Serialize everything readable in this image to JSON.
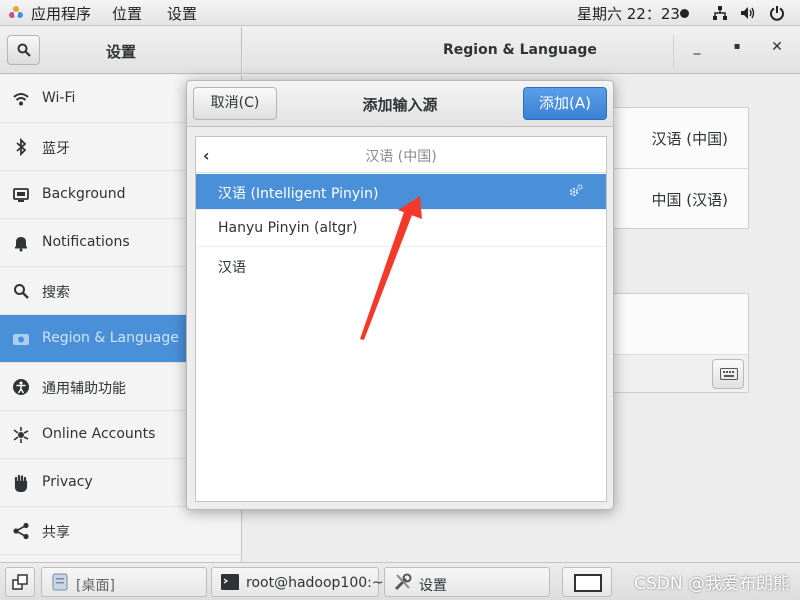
{
  "topbar": {
    "apps_label": "应用程序",
    "places_label": "位置",
    "settings_label": "设置",
    "clock": "星期六 22：23"
  },
  "window": {
    "sidebar_title": "设置",
    "panel_title": "Region & Language",
    "minimize_glyph": "_",
    "maximize_glyph": "▪",
    "close_glyph": "✕"
  },
  "sidebar": {
    "items": [
      {
        "label": "Wi-Fi",
        "icon": "wifi-icon"
      },
      {
        "label": "蓝牙",
        "icon": "bluetooth-icon"
      },
      {
        "label": "Background",
        "icon": "background-icon"
      },
      {
        "label": "Notifications",
        "icon": "bell-icon"
      },
      {
        "label": "搜索",
        "icon": "search-icon"
      },
      {
        "label": "Region & Language",
        "icon": "region-icon",
        "active": true
      },
      {
        "label": "通用辅助功能",
        "icon": "accessibility-icon"
      },
      {
        "label": "Online Accounts",
        "icon": "online-accounts-icon"
      },
      {
        "label": "Privacy",
        "icon": "hand-icon"
      },
      {
        "label": "共享",
        "icon": "share-icon"
      }
    ]
  },
  "content": {
    "language_value": "汉语 (中国)",
    "formats_value": "中国 (汉语)"
  },
  "dialog": {
    "cancel_label": "取消(C)",
    "title": "添加输入源",
    "add_label": "添加(A)",
    "header_language": "汉语 (中国)",
    "back_glyph": "‹",
    "rows": [
      {
        "label": "汉语 (Intelligent Pinyin)",
        "selected": true
      },
      {
        "label": "Hanyu Pinyin (altgr)",
        "selected": false
      },
      {
        "label": "汉语",
        "selected": false
      }
    ]
  },
  "taskbar": {
    "desktop_label": "[桌面]",
    "terminal_label": "root@hadoop100:~",
    "settings_label": "设置",
    "watermark": "CSDN @我爱布朗熊"
  },
  "colors": {
    "accent": "#4a90d9",
    "arrow": "#f33a2a"
  }
}
